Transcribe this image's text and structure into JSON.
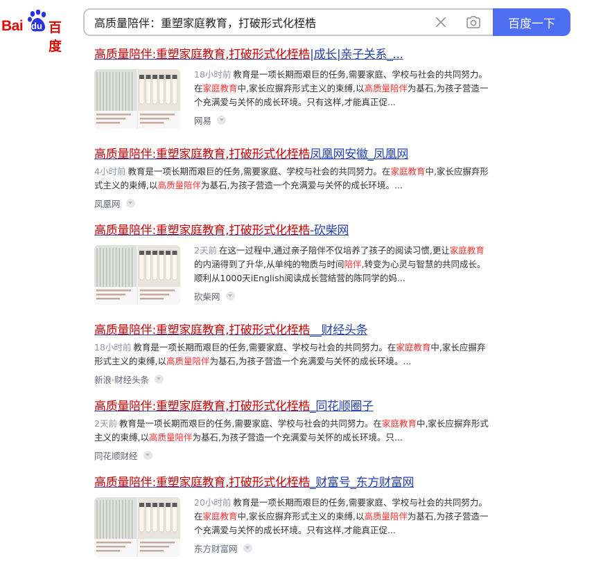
{
  "logo": {
    "bai": "Bai",
    "du": "du",
    "cn": "百度"
  },
  "search": {
    "value": "高质量陪伴：重塑家庭教育，打破形式化桎梏",
    "button_label": "百度一下"
  },
  "icons": {
    "clear": "close-icon",
    "camera": "camera-icon",
    "more": "chevron-down-icon"
  },
  "colors": {
    "brand_red": "#e10602",
    "link_blue": "#2440b3",
    "highlight_red": "#f73131",
    "button_blue": "#4e6ef2"
  },
  "results": [
    {
      "title_hl": "高质量陪伴:重塑家庭教育,打破形式化桎梏",
      "title_rest": "|成长|亲子关系_...",
      "has_image": true,
      "time": "18小时前",
      "snippet": [
        {
          "t": "教育是一项长期而艰巨的任务,需要家庭、学校与社会的共同努力。在"
        },
        {
          "t": "家庭教育",
          "hl": true
        },
        {
          "t": "中,家长应摒弃形式主义的束缚,以"
        },
        {
          "t": "高质量陪伴",
          "hl": true
        },
        {
          "t": "为基石,为孩子营造一个充满爱与关怀的成长环境。只有这样,才能真正促..."
        }
      ],
      "source": "网易"
    },
    {
      "title_hl": "高质量陪伴:重塑家庭教育,打破形式化桎梏",
      "title_rest": "凤凰网安徽_凤凰网",
      "has_image": false,
      "time": "4小时前",
      "snippet": [
        {
          "t": "教育是一项长期而艰巨的任务,需要家庭、学校与社会的共同努力。在"
        },
        {
          "t": "家庭教育",
          "hl": true
        },
        {
          "t": "中,家长应摒弃形式主义的束缚,以"
        },
        {
          "t": "高质量陪伴",
          "hl": true
        },
        {
          "t": "为基石,为孩子营造一个充满爱与关怀的成长环境。..."
        }
      ],
      "source": "凤凰网"
    },
    {
      "title_hl": "高质量陪伴:重塑家庭教育,打破形式化桎梏",
      "title_rest": "-砍柴网",
      "has_image": true,
      "time": "2天前",
      "snippet": [
        {
          "t": "在这一过程中,通过亲子陪伴不仅培养了孩子的阅读习惯,更让"
        },
        {
          "t": "家庭教育",
          "hl": true
        },
        {
          "t": "的内涵得到了升华,从单纯的物质与时间"
        },
        {
          "t": "陪伴",
          "hl": true
        },
        {
          "t": ",转变为心灵与智慧的共同成长。 顺利从1000天iEnglish阅读成长营结营的陈同学的妈..."
        }
      ],
      "source": "砍柴网"
    },
    {
      "title_hl": "高质量陪伴:重塑家庭教育,打破形式化桎梏",
      "title_rest": "__财经头条",
      "has_image": false,
      "time": "18小时前",
      "snippet": [
        {
          "t": "教育是一项长期而艰巨的任务,需要家庭、学校与社会的共同努力。在"
        },
        {
          "t": "家庭教育",
          "hl": true
        },
        {
          "t": "中,家长应摒弃形式主义的束缚,以"
        },
        {
          "t": "高质量陪伴",
          "hl": true
        },
        {
          "t": "为基石,为孩子营造一个充满爱与关怀的成长环境。..."
        }
      ],
      "source": "新浪·财经头条"
    },
    {
      "title_hl": "高质量陪伴:重塑家庭教育,打破形式化桎梏",
      "title_rest": "_同花顺圈子",
      "has_image": false,
      "time": "2天前",
      "snippet": [
        {
          "t": "教育是一项长期而艰巨的任务,需要家庭、学校与社会的共同努力。在"
        },
        {
          "t": "家庭教育",
          "hl": true
        },
        {
          "t": "中,家长应摒弃形式主义的束缚,以"
        },
        {
          "t": "高质量陪伴",
          "hl": true
        },
        {
          "t": "为基石,为孩子营造一个充满爱与关怀的成长环境。只..."
        }
      ],
      "source": "同花顺财经"
    },
    {
      "title_hl": "高质量陪伴:重塑家庭教育,打破形式化桎梏",
      "title_rest": "_财富号_东方财富网",
      "has_image": true,
      "time": "20小时前",
      "snippet": [
        {
          "t": "教育是一项长期而艰巨的任务,需要家庭、学校与社会的共同努力。在"
        },
        {
          "t": "家庭教育",
          "hl": true
        },
        {
          "t": "中,家长应摒弃形式主义的束缚,以"
        },
        {
          "t": "高质量陪伴",
          "hl": true
        },
        {
          "t": "为基石,为孩子营造一个充满爱与关怀的成长环境。只有这样,才能真正促..."
        }
      ],
      "source": "东方财富网"
    }
  ]
}
